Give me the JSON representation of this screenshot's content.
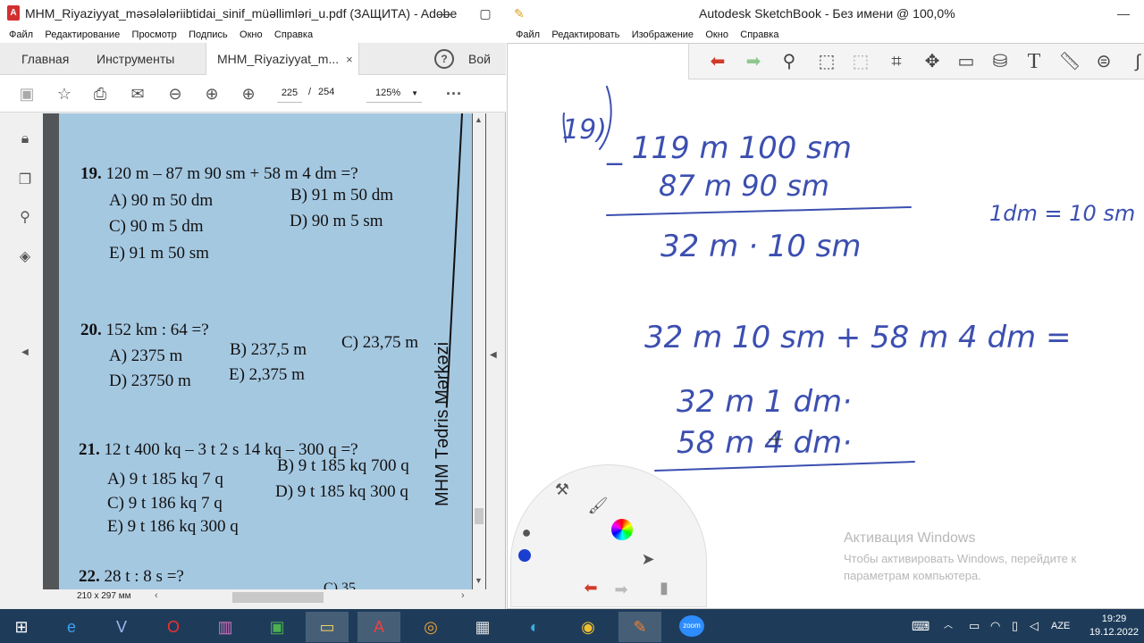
{
  "acrobat": {
    "title": "MHM_Riyaziyyat_məsələləriibtidai_sinif_müəllimləri_u.pdf (ЗАЩИТА) - Adobe",
    "menu": [
      "Файл",
      "Редактирование",
      "Просмотр",
      "Подпись",
      "Окно",
      "Справка"
    ],
    "tabs": {
      "home": "Главная",
      "tools": "Инструменты",
      "doc": "MHM_Riyaziyyat_m...",
      "signin": "Вой"
    },
    "page_current": "225",
    "page_sep": "/",
    "page_total": "254",
    "zoom": "125%",
    "page_size": "210 x 297 мм"
  },
  "pdf": {
    "p19": {
      "num": "19.",
      "text": "120 m – 87 m 90 sm + 58 m 4 dm =?",
      "a": "A) 90 m 50 dm",
      "b": "B) 91 m 50 dm",
      "c": "C) 90 m 5 dm",
      "d": "D) 90 m 5 sm",
      "e": "E) 91 m 50 sm"
    },
    "p20": {
      "num": "20.",
      "text": "152 km : 64 =?",
      "a": "A) 2375 m",
      "b": "B) 237,5 m",
      "c": "C) 23,75 m",
      "d": "D) 23750 m",
      "e": "E) 2,375 m"
    },
    "p21": {
      "num": "21.",
      "text": "12 t 400 kq – 3 t 2 s 14 kq – 300 q =?",
      "a": "A) 9 t 185 kq 7 q",
      "b": "B) 9 t 185 kq 700 q",
      "c": "C) 9 t 186 kq 7 q",
      "d": "D) 9 t 185 kq 300 q",
      "e": "E) 9 t 186 kq 300 q"
    },
    "p22": {
      "num": "22.",
      "text": "28 t : 8 s =?",
      "partial": "C) 35"
    },
    "side_text": "MHM Tədris Mərkəzi"
  },
  "sketchbook": {
    "title": "Autodesk SketchBook - Без имени @ 100,0%",
    "menu": [
      "Файл",
      "Редактировать",
      "Изображение",
      "Окно",
      "Справка"
    ],
    "handwriting": {
      "label": "19)",
      "line1": "_ 119 m 100 sm",
      "line2": "87 m 90 sm",
      "result": "32 m · 10 sm",
      "note": "1dm = 10 sm",
      "expr": "32 m 10 sm + 58 m 4 dm =",
      "l3": "32 m 1 dm·",
      "l4": "58 m 4 dm·"
    },
    "ink_color": "#3c4fb0",
    "activation_title": "Активация Windows",
    "activation_text1": "Чтобы активировать Windows, перейдите к",
    "activation_text2": "параметрам компьютера."
  },
  "taskbar": {
    "lang": "AZE",
    "time": "19:29",
    "date": "19.12.2022",
    "zoom_label": "zoom"
  }
}
